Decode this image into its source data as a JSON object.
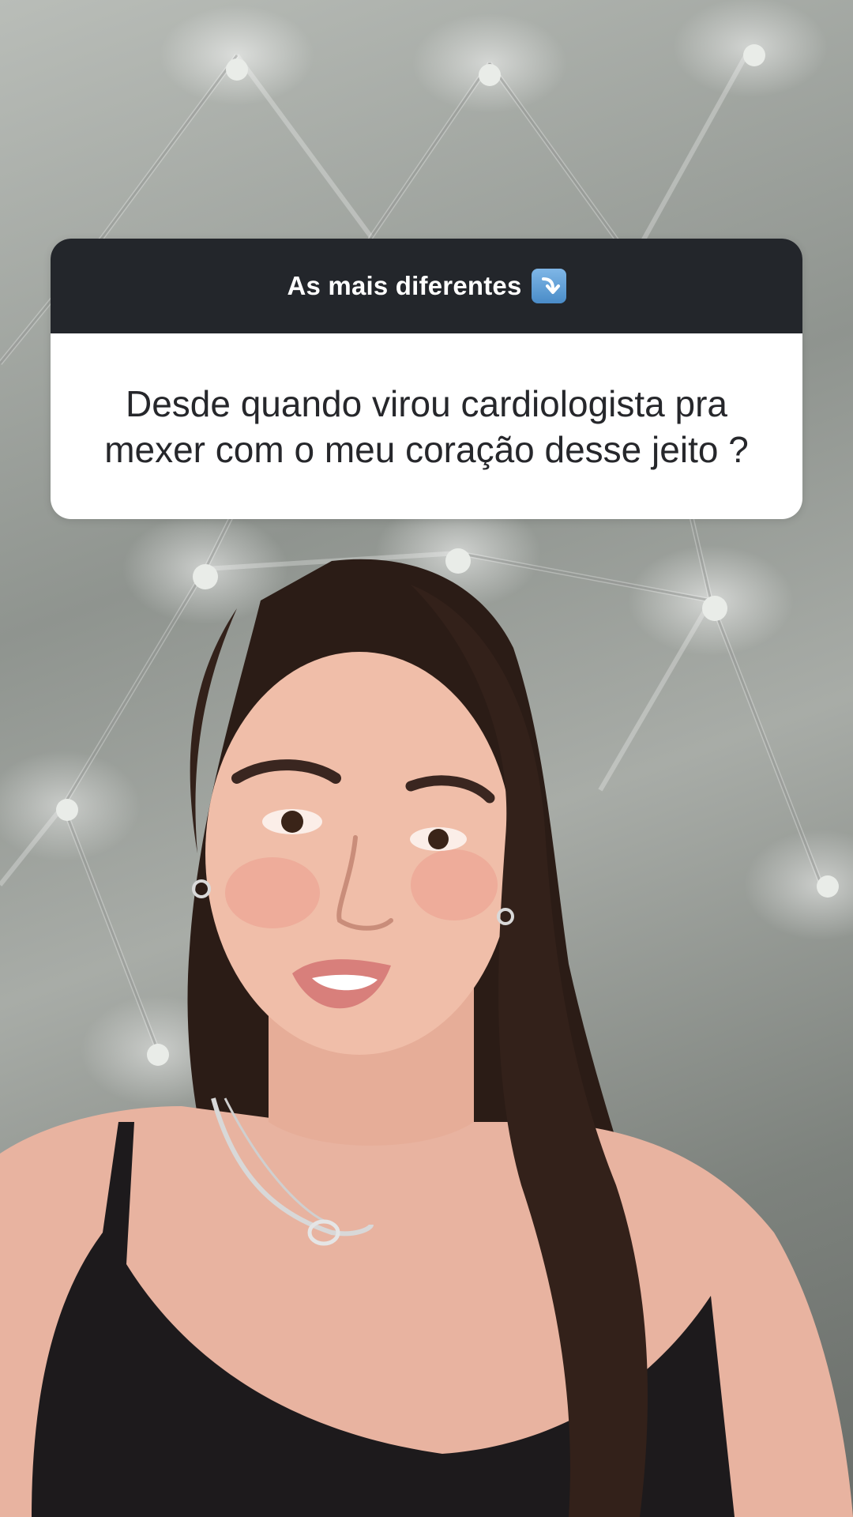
{
  "story": {
    "question_sticker": {
      "prompt": "As mais diferentes",
      "prompt_icon": "arrow-down-right-emoji-icon",
      "question": "Desde quando virou cardiologista pra mexer com o meu coração desse jeito ?"
    },
    "background": {
      "icon": "tufted-headboard",
      "colors": {
        "sticker_header": "#23262b",
        "sticker_body": "#ffffff",
        "arrow_emoji": "#5b9bd5"
      }
    }
  }
}
